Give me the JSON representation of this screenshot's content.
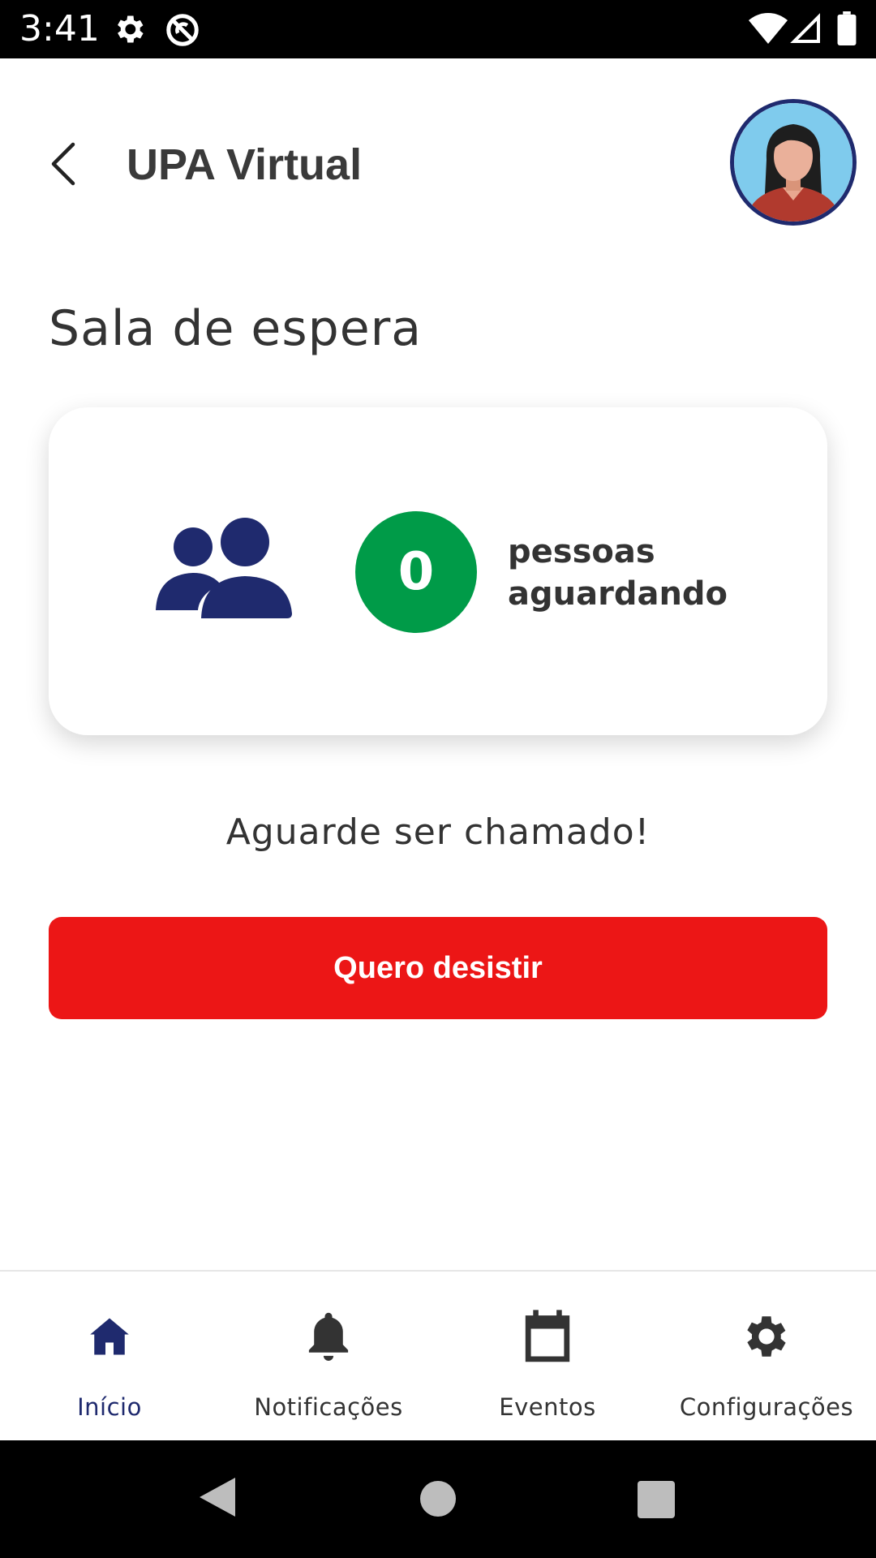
{
  "status_bar": {
    "time": "3:41",
    "icons": [
      "settings-icon",
      "do-not-disturb-icon",
      "wifi-icon",
      "signal-icon",
      "battery-icon"
    ]
  },
  "header": {
    "title": "UPA Virtual",
    "back_icon": "chevron-left-icon",
    "avatar": "user-avatar"
  },
  "page": {
    "section_title": "Sala de espera",
    "waiting_card": {
      "icon": "people-icon",
      "count": "0",
      "label_line1": "pessoas",
      "label_line2": "aguardando"
    },
    "message": "Aguarde ser chamado!",
    "give_up_button": "Quero desistir"
  },
  "bottom_nav": {
    "items": [
      {
        "label": "Início",
        "icon": "home-icon",
        "active": true
      },
      {
        "label": "Notificações",
        "icon": "bell-icon",
        "active": false
      },
      {
        "label": "Eventos",
        "icon": "calendar-icon",
        "active": false
      },
      {
        "label": "Configurações",
        "icon": "gear-icon",
        "active": false
      }
    ]
  },
  "colors": {
    "primary": "#1f2a6e",
    "success": "#009b48",
    "danger": "#ec1616",
    "text": "#333333"
  }
}
